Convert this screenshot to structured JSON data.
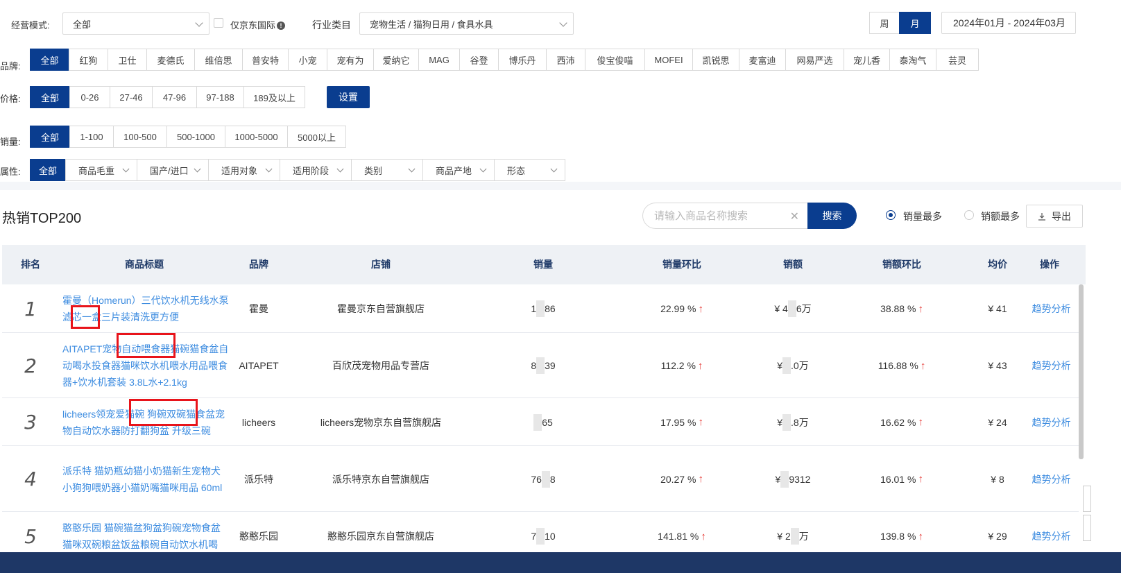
{
  "filters": {
    "mode_label": "经营模式:",
    "mode_value": "全部",
    "jd_intl_label": "仅京东国际",
    "industry_label": "行业类目",
    "industry_value": "宠物生活 / 猫狗日用 / 食具水具",
    "period_week": "周",
    "period_month": "月",
    "date_range": "2024年01月 - 2024年03月",
    "brand_label": "品牌:",
    "brands": [
      "全部",
      "红狗",
      "卫仕",
      "麦德氏",
      "维倍思",
      "普安特",
      "小宠",
      "宠有为",
      "爱纳它",
      "MAG",
      "谷登",
      "博乐丹",
      "西沛",
      "俊宝俊喵",
      "MOFEI",
      "凯锐思",
      "麦富迪",
      "网易严选",
      "宠儿香",
      "泰淘气",
      "芸灵"
    ],
    "price_label": "价格:",
    "prices": [
      "全部",
      "0-26",
      "27-46",
      "47-96",
      "97-188",
      "189及以上"
    ],
    "price_set": "设置",
    "sales_label": "销量:",
    "sales": [
      "全部",
      "1-100",
      "100-500",
      "500-1000",
      "1000-5000",
      "5000以上"
    ],
    "attr_label": "属性:",
    "attrs": [
      "全部",
      "商品毛重",
      "国产/进口",
      "适用对象",
      "适用阶段",
      "类别",
      "商品产地",
      "形态"
    ]
  },
  "section": {
    "title": "热销TOP200",
    "search_placeholder": "请输入商品名称搜索",
    "search_button": "搜索",
    "sort_sales": "销量最多",
    "sort_amount": "销额最多",
    "export": "导出"
  },
  "table": {
    "headers": [
      "排名",
      "商品标题",
      "品牌",
      "店铺",
      "销量",
      "销量环比",
      "销额",
      "销额环比",
      "均价",
      "操作"
    ],
    "rows": [
      {
        "rank": "1",
        "title": "霍曼（Homerun）三代饮水机无线水泵滤芯一盒三片装清洗更方便",
        "brand": "霍曼",
        "shop": "霍曼京东自营旗舰店",
        "sales_a": "1",
        "sales_b": "86",
        "sales_mom": "22.99 %",
        "amount_a": "¥ 4",
        "amount_b": "6万",
        "amount_mom": "38.88 %",
        "avg": "¥ 41",
        "action": "趋势分析"
      },
      {
        "rank": "2",
        "title": "AITAPET宠物自动喂食器猫碗猫食盆自动喝水投食器猫咪饮水机喂水用品喂食器+饮水机套装 3.8L水+2.1kg",
        "brand": "AITAPET",
        "shop": "百欣茂宠物用品专营店",
        "sales_a": "8",
        "sales_b": "39",
        "sales_mom": "112.2 %",
        "amount_a": "¥ ",
        "amount_b": ".0万",
        "amount_mom": "116.88 %",
        "avg": "¥ 43",
        "action": "趋势分析"
      },
      {
        "rank": "3",
        "title": "licheers领宠爱猫碗 狗碗双碗猫食盆宠物自动饮水器防打翻狗盆 升级三碗",
        "brand": "licheers",
        "shop": "licheers宠物京东自营旗舰店",
        "sales_a": "",
        "sales_b": "65",
        "sales_mom": "17.95 %",
        "amount_a": "¥ ",
        "amount_b": ".8万",
        "amount_mom": "16.62 %",
        "avg": "¥ 24",
        "action": "趋势分析"
      },
      {
        "rank": "4",
        "title": "派乐特 猫奶瓶幼猫小奶猫新生宠物犬小狗狗喂奶器小猫奶嘴猫咪用品 60ml",
        "brand": "派乐特",
        "shop": "派乐特京东自营旗舰店",
        "sales_a": "76",
        "sales_b": "8",
        "sales_mom": "20.27 %",
        "amount_a": "¥ ",
        "amount_b": "9312",
        "amount_mom": "16.01 %",
        "avg": "¥ 8",
        "action": "趋势分析"
      },
      {
        "rank": "5",
        "title": "憨憨乐园 猫碗猫盆狗盆狗碗宠物食盆猫咪双碗粮盆饭盆粮碗自动饮水机喝",
        "brand": "憨憨乐园",
        "shop": "憨憨乐园京东自营旗舰店",
        "sales_a": "7",
        "sales_b": "10",
        "sales_mom": "141.81 %",
        "amount_a": "¥ 2",
        "amount_b": "万",
        "amount_mom": "139.8 %",
        "avg": "¥ 29",
        "action": "趋势分析"
      }
    ]
  },
  "colors": {
    "primary": "#0a3d8f",
    "link": "#3d8ce0",
    "up": "#e53935",
    "highlight": "#e8141b"
  }
}
